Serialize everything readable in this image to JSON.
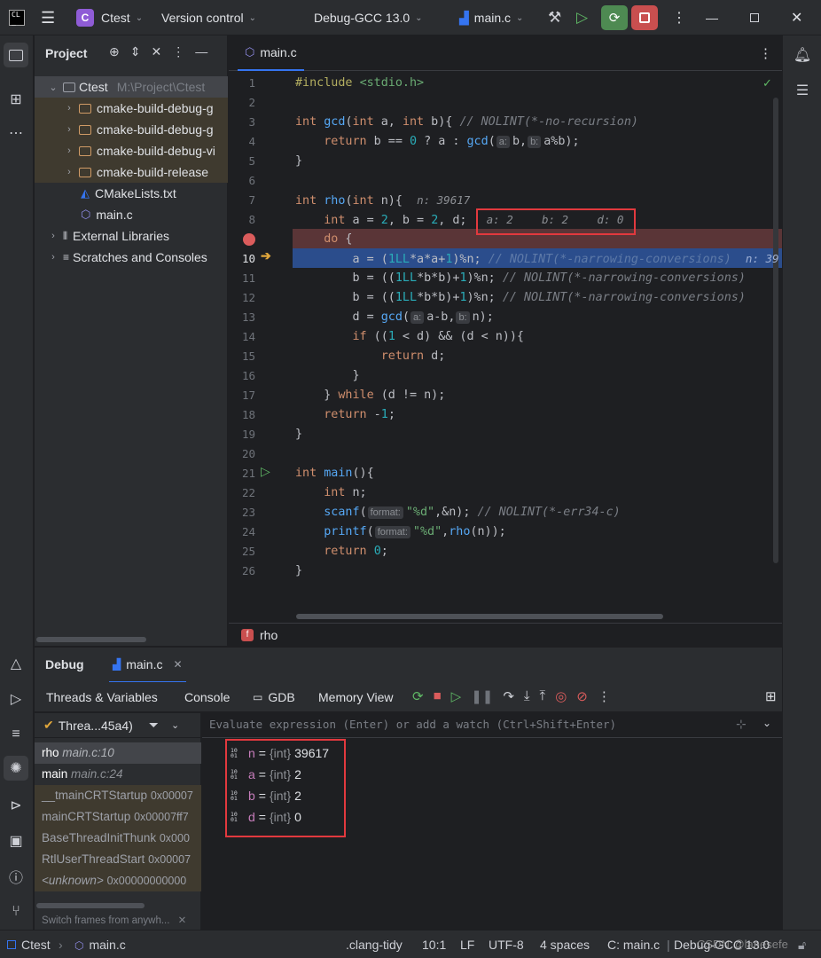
{
  "titlebar": {
    "project_badge": "C",
    "project_name": "Ctest",
    "vcs": "Version control",
    "run_config": "Debug-GCC 13.0",
    "file_config": "main.c"
  },
  "project_panel": {
    "title": "Project",
    "root_name": "Ctest",
    "root_path": "M:\\Project\\Ctest",
    "items": [
      {
        "label": "cmake-build-debug-g"
      },
      {
        "label": "cmake-build-debug-g"
      },
      {
        "label": "cmake-build-debug-vi"
      },
      {
        "label": "cmake-build-release"
      },
      {
        "label": "CMakeLists.txt"
      },
      {
        "label": "main.c"
      }
    ],
    "external_libraries": "External Libraries",
    "scratches": "Scratches and Consoles"
  },
  "editor": {
    "tab_label": "main.c",
    "breadcrumb_badge": "f",
    "breadcrumb": "rho",
    "hint_n": "n: 39617",
    "hint_a_b_d": {
      "a": "a: 2",
      "b": "b: 2",
      "d": "d: 0"
    },
    "hint_line10": "n: 39",
    "param_hint_a": "a:",
    "param_hint_b": "b:",
    "param_hint_format": "format:"
  },
  "debug": {
    "title": "Debug",
    "session_tab": "main.c",
    "tabs": [
      "Threads & Variables",
      "Console",
      "GDB",
      "Memory View"
    ],
    "thread_label": "Threa...45a4)",
    "evaluate_placeholder": "Evaluate expression (Enter) or add a watch (Ctrl+Shift+Enter)",
    "frames": [
      {
        "name": "rho",
        "loc": "main.c:10"
      },
      {
        "name": "main",
        "loc": "main.c:24"
      },
      {
        "name": "__tmainCRTStartup",
        "loc": "0x00007"
      },
      {
        "name": "mainCRTStartup",
        "loc": "0x00007ff7"
      },
      {
        "name": "BaseThreadInitThunk",
        "loc": "0x000"
      },
      {
        "name": "RtlUserThreadStart",
        "loc": "0x00007"
      },
      {
        "name": "<unknown>",
        "loc": "0x00000000000"
      }
    ],
    "frames_hint": "Switch frames from anywh...",
    "variables": [
      {
        "name": "n",
        "type": "{int}",
        "value": "39617"
      },
      {
        "name": "a",
        "type": "{int}",
        "value": "2"
      },
      {
        "name": "b",
        "type": "{int}",
        "value": "2"
      },
      {
        "name": "d",
        "type": "{int}",
        "value": "0"
      }
    ]
  },
  "statusbar": {
    "project": "Ctest",
    "file": "main.c",
    "linter": ".clang-tidy",
    "position": "10:1",
    "line_sep": "LF",
    "encoding": "UTF-8",
    "indent": "4 spaces",
    "context": "C: main.c",
    "config": "Debug-GCC 13.0",
    "watermark": "CSDN @lanesefe"
  },
  "colors": {
    "accent": "#3574f0",
    "breakpoint": "#db5c5c",
    "run_green": "#5fb865",
    "stop_red": "#c94f4f",
    "highlight_box": "#e2393e"
  }
}
